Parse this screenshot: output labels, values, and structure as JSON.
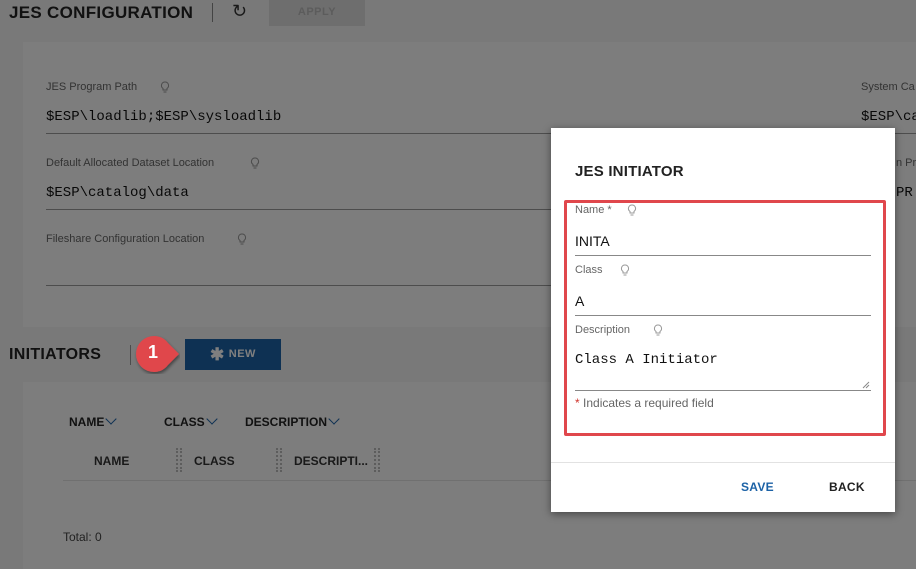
{
  "header": {
    "title": "JES CONFIGURATION",
    "refresh_icon": "↻",
    "apply_label": "APPLY"
  },
  "config": {
    "program_path": {
      "label": "JES Program Path",
      "value": "$ESP\\loadlib;$ESP\\sysloadlib"
    },
    "dataset_location": {
      "label": "Default Allocated Dataset Location",
      "value": "$ESP\\catalog\\data"
    },
    "fileshare_location": {
      "label": "Fileshare Configuration Location",
      "value": ""
    },
    "system_catalog": {
      "label": "System Ca",
      "value": "$ESP\\cat"
    },
    "right_second": {
      "label": "n Pr",
      "value": "PR"
    }
  },
  "initiators": {
    "title": "INITIATORS",
    "new_label": "NEW",
    "new_icon": "✱",
    "callout_number": "1",
    "sort_headers": [
      "NAME",
      "CLASS",
      "DESCRIPTION"
    ],
    "columns": [
      "NAME",
      "CLASS",
      "DESCRIPTI..."
    ],
    "total": "Total: 0"
  },
  "dialog": {
    "title": "JES INITIATOR",
    "name_label": "Name *",
    "name_value": "INITA",
    "class_label": "Class",
    "class_value": "A",
    "description_label": "Description",
    "description_value": "Class A Initiator",
    "required_asterisk": "*",
    "required_note": "Indicates a required field",
    "save_label": "SAVE",
    "back_label": "BACK"
  },
  "colors": {
    "accent": "#1c62a6",
    "highlight": "#e0474c",
    "callout": "#e0474c"
  }
}
